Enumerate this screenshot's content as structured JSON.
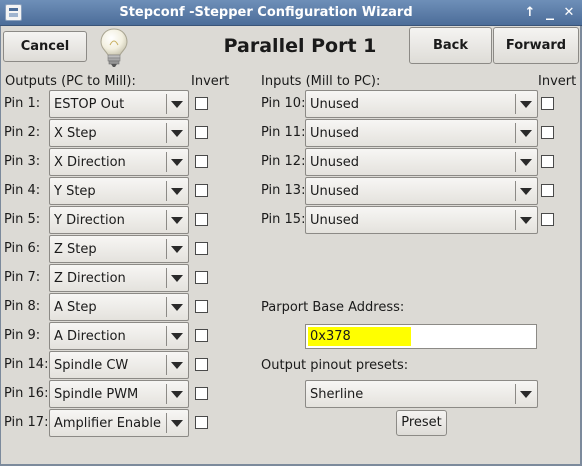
{
  "window": {
    "title": "Stepconf -Stepper Configuration Wizard",
    "buttons": {
      "collapse": "↑",
      "minimize": "✕",
      "close": "✕"
    }
  },
  "toolbar": {
    "cancel_label": "Cancel",
    "back_label": "Back",
    "forward_label": "Forward",
    "page_title": "Parallel Port 1"
  },
  "outputs": {
    "header": "Outputs (PC to Mill):",
    "invert_header": "Invert",
    "pins": [
      {
        "label": "Pin 1:",
        "value": "ESTOP Out",
        "invert": false
      },
      {
        "label": "Pin 2:",
        "value": "X Step",
        "invert": false
      },
      {
        "label": "Pin 3:",
        "value": "X Direction",
        "invert": false
      },
      {
        "label": "Pin 4:",
        "value": "Y Step",
        "invert": false
      },
      {
        "label": "Pin 5:",
        "value": "Y Direction",
        "invert": false
      },
      {
        "label": "Pin 6:",
        "value": "Z Step",
        "invert": false
      },
      {
        "label": "Pin 7:",
        "value": "Z Direction",
        "invert": false
      },
      {
        "label": "Pin 8:",
        "value": "A Step",
        "invert": false
      },
      {
        "label": "Pin 9:",
        "value": "A Direction",
        "invert": false
      },
      {
        "label": "Pin 14:",
        "value": "Spindle CW",
        "invert": false
      },
      {
        "label": "Pin 16:",
        "value": "Spindle PWM",
        "invert": false
      },
      {
        "label": "Pin 17:",
        "value": "Amplifier Enable",
        "invert": false
      }
    ]
  },
  "inputs": {
    "header": "Inputs (Mill to PC):",
    "invert_header": "Invert",
    "pins": [
      {
        "label": "Pin 10:",
        "value": "Unused",
        "invert": false
      },
      {
        "label": "Pin 11:",
        "value": "Unused",
        "invert": false
      },
      {
        "label": "Pin 12:",
        "value": "Unused",
        "invert": false
      },
      {
        "label": "Pin 13:",
        "value": "Unused",
        "invert": false
      },
      {
        "label": "Pin 15:",
        "value": "Unused",
        "invert": false
      }
    ]
  },
  "parport": {
    "address_label": "Parport Base Address:",
    "address_value": "0x378",
    "highlight_color": "#ffff00"
  },
  "presets": {
    "label": "Output pinout presets:",
    "selected": "Sherline",
    "apply_label": "Preset"
  },
  "icons": {
    "hint": "lightbulb-icon",
    "dropdown": "chevron-down-icon"
  }
}
